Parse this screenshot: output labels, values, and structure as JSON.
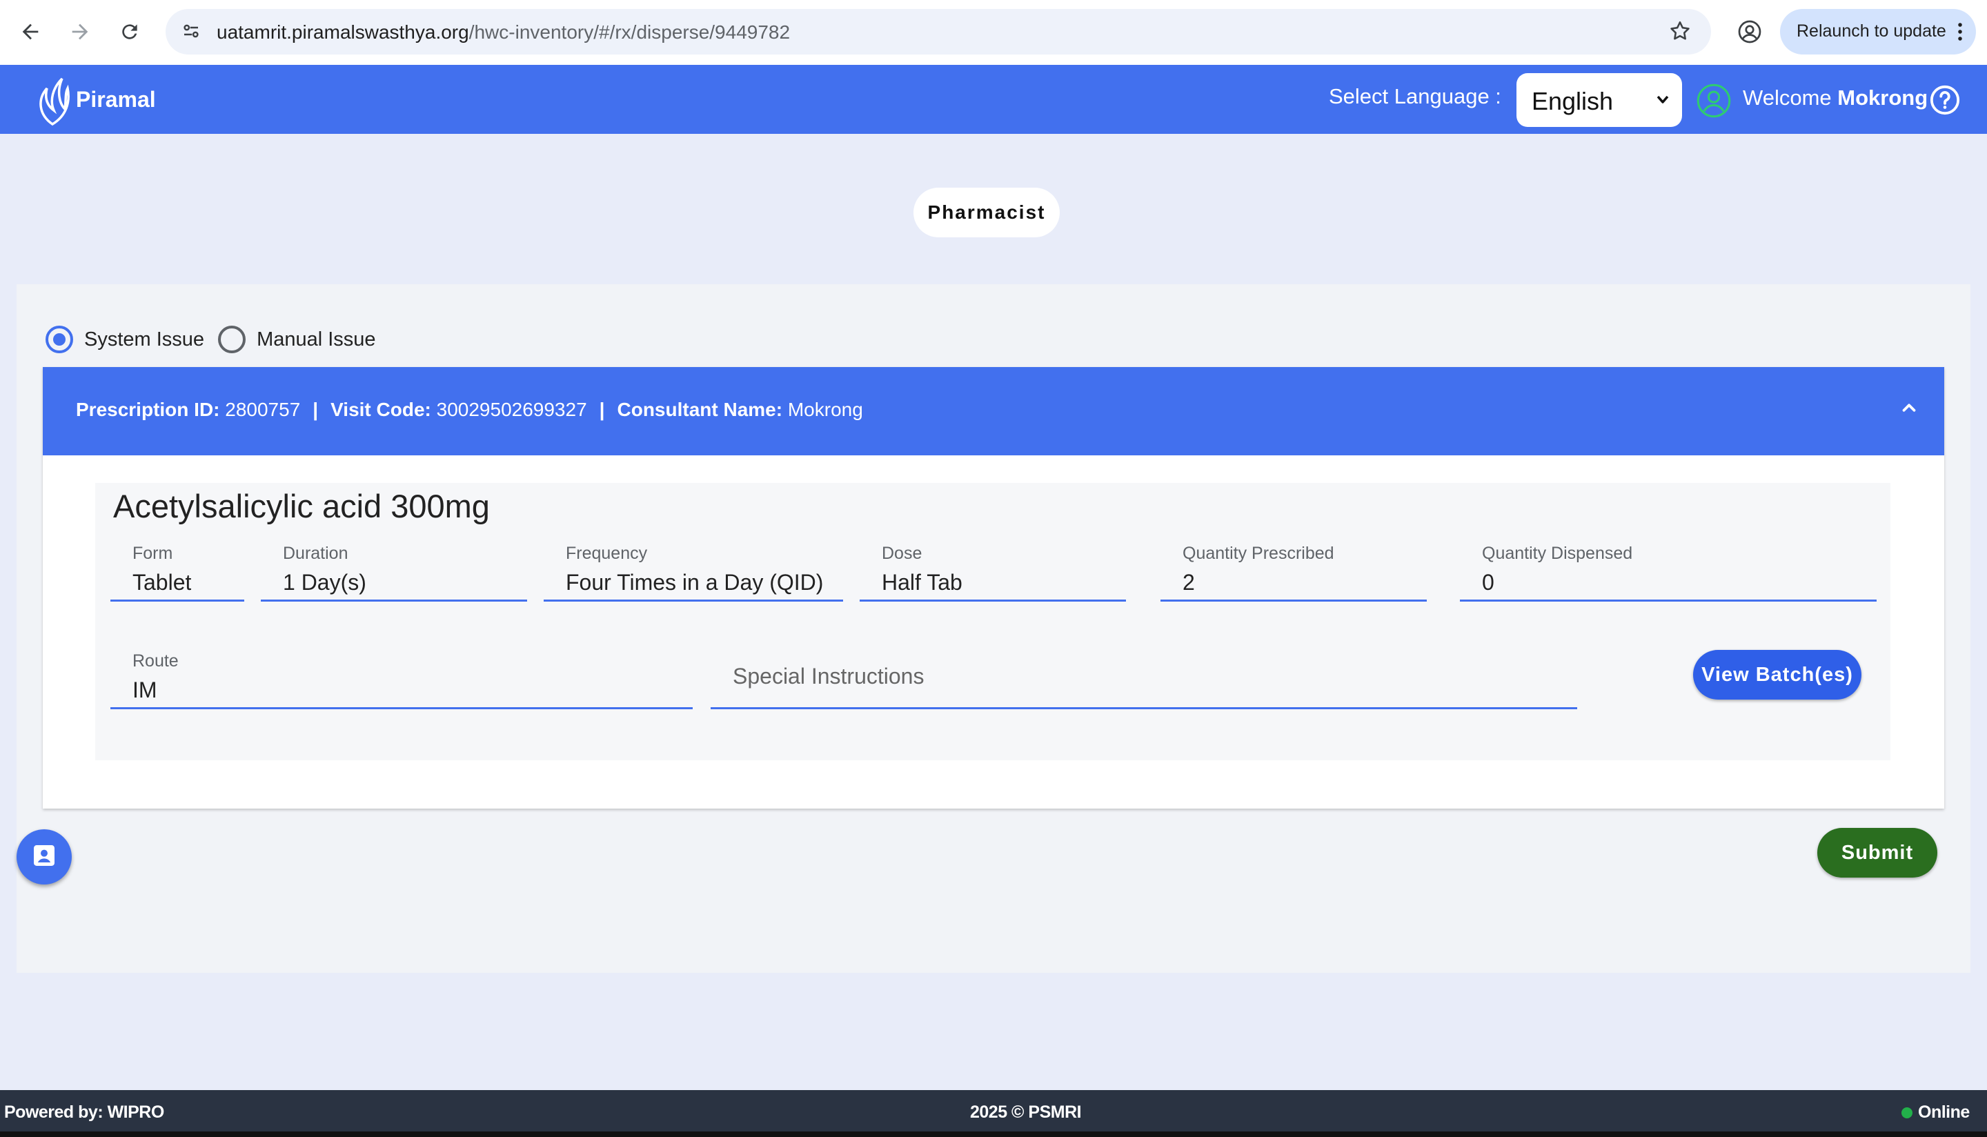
{
  "browser": {
    "url_host": "uatamrit.piramalswasthya.org",
    "url_path": "/hwc-inventory/#/rx/disperse/9449782",
    "relaunch_label": "Relaunch to update"
  },
  "header": {
    "logo_text": "Piramal",
    "language_label": "Select Language :",
    "language_value": "English",
    "welcome_prefix": "Welcome",
    "welcome_user": "Mokrong"
  },
  "role": "Pharmacist",
  "issue_type": {
    "options": [
      "System Issue",
      "Manual Issue"
    ],
    "selected": "System Issue"
  },
  "prescription": {
    "id_label": "Prescription ID:",
    "id_value": "2800757",
    "visit_label": "Visit Code:",
    "visit_value": "30029502699327",
    "consultant_label": "Consultant Name:",
    "consultant_value": "Mokrong",
    "separator": "|"
  },
  "drug": {
    "name": "Acetylsalicylic acid 300mg",
    "fields": {
      "form": {
        "label": "Form",
        "value": "Tablet"
      },
      "duration": {
        "label": "Duration",
        "value": "1 Day(s)"
      },
      "frequency": {
        "label": "Frequency",
        "value": "Four Times in a Day (QID)"
      },
      "dose": {
        "label": "Dose",
        "value": "Half Tab"
      },
      "qty_prescribed": {
        "label": "Quantity Prescribed",
        "value": "2"
      },
      "qty_dispensed": {
        "label": "Quantity Dispensed",
        "value": "0"
      },
      "route": {
        "label": "Route",
        "value": "IM"
      },
      "special_instructions": {
        "placeholder": "Special Instructions"
      }
    },
    "view_batch_label": "View Batch(es)"
  },
  "submit_label": "Submit",
  "footer": {
    "powered_by": "Powered by: WIPRO",
    "copyright": "2025 © PSMRI",
    "status": "Online"
  },
  "colors": {
    "brand_blue": "#4270ee",
    "submit_green": "#2a6e1f",
    "footer_bg": "#2a3342",
    "online_green": "#22b04a"
  },
  "icons": [
    "back-arrow-icon",
    "forward-arrow-icon",
    "reload-icon",
    "site-settings-icon",
    "bookmark-star-icon",
    "profile-icon",
    "kebab-menu-icon",
    "user-circle-icon",
    "help-icon",
    "chevron-up-icon",
    "contact-card-icon"
  ]
}
